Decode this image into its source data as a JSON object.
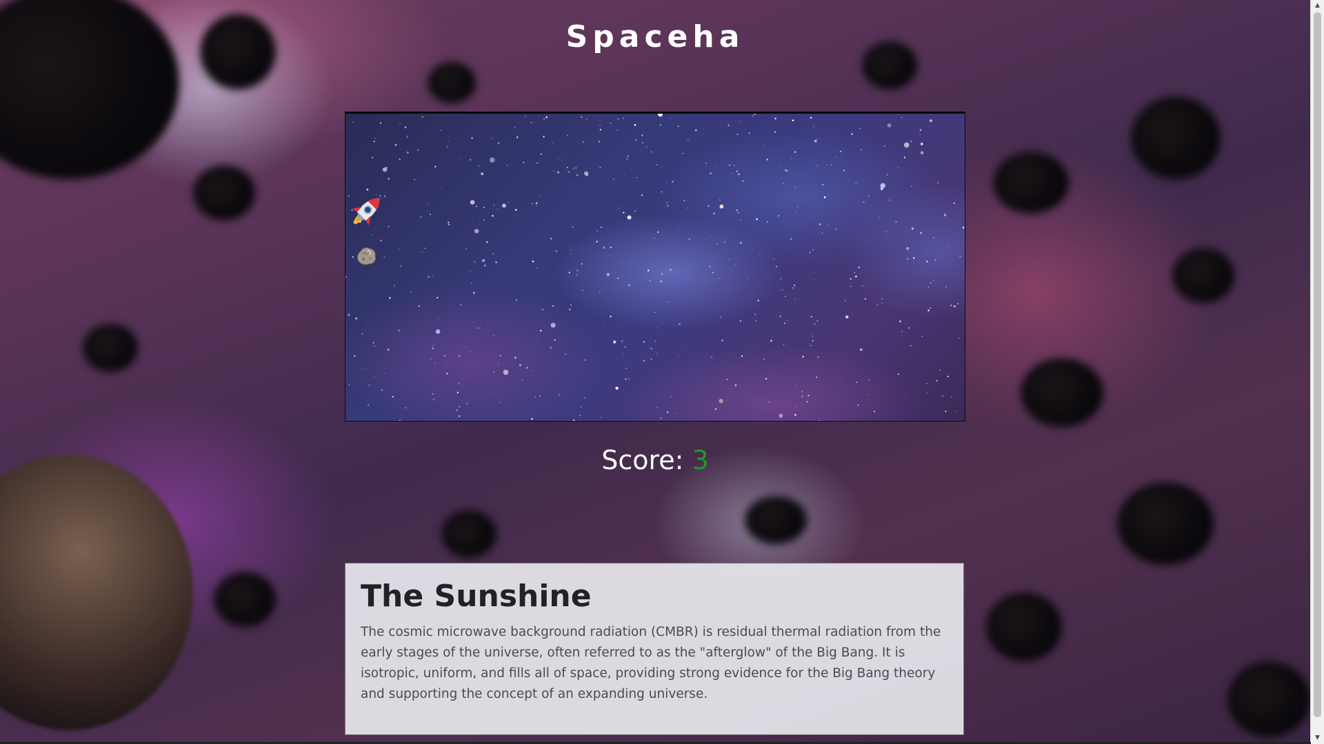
{
  "page": {
    "title": "Spaceha"
  },
  "game": {
    "player_icon": "rocket-icon",
    "obstacle_icon": "asteroid-icon",
    "score_label": "Score:",
    "score_value": "3"
  },
  "info": {
    "heading": "The Sunshine",
    "body": "The cosmic microwave background radiation (CMBR) is residual thermal radiation from the early stages of the universe, often referred to as the \"afterglow\" of the Big Bang. It is isotropic, uniform, and fills all of space, providing strong evidence for the Big Bang theory and supporting the concept of an expanding universe."
  },
  "colors": {
    "score_value": "#1f9a2b",
    "title": "#ffffff"
  }
}
